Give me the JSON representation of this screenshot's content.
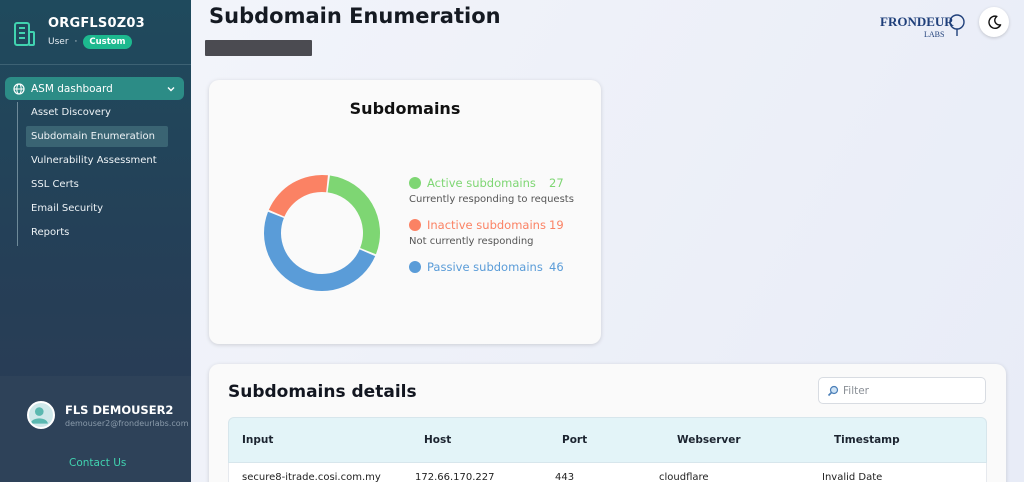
{
  "sidebar": {
    "org_name": "ORGFLS0Z03",
    "role": "User",
    "separator": "·",
    "badge": "Custom",
    "section": "ASM dashboard",
    "items": [
      {
        "label": "Asset Discovery",
        "active": false
      },
      {
        "label": "Subdomain Enumeration",
        "active": true
      },
      {
        "label": "Vulnerability Assessment",
        "active": false
      },
      {
        "label": "SSL Certs",
        "active": false
      },
      {
        "label": "Email Security",
        "active": false
      },
      {
        "label": "Reports",
        "active": false
      }
    ],
    "user": {
      "name": "FLS DEMOUSER2",
      "email": "demouser2@frondeurlabs.com",
      "contact": "Contact Us"
    }
  },
  "header": {
    "title": "Subdomain Enumeration",
    "logo_text": "FRONDEUR",
    "logo_sub": "LABS"
  },
  "summary": {
    "title": "Subdomains",
    "colors": {
      "active": "#7ed673",
      "inactive": "#fb8264",
      "passive": "#5a9cd8"
    },
    "legend": [
      {
        "label": "Active subdomains",
        "value": "27",
        "desc": "Currently responding to requests",
        "color": "#7ed673"
      },
      {
        "label": "Inactive subdomains",
        "value": "19",
        "desc": "Not currently responding",
        "color": "#fb8264"
      },
      {
        "label": "Passive subdomains",
        "value": "46",
        "desc": "",
        "color": "#5a9cd8"
      }
    ]
  },
  "chart_data": {
    "type": "pie",
    "categories": [
      "Active subdomains",
      "Inactive subdomains",
      "Passive subdomains"
    ],
    "values": [
      27,
      19,
      46
    ],
    "title": "Subdomains",
    "colors": [
      "#7ed673",
      "#fb8264",
      "#5a9cd8"
    ]
  },
  "details": {
    "title": "Subdomains details",
    "filter_placeholder": "Filter",
    "columns": [
      "Input",
      "Host",
      "Port",
      "Webserver",
      "Timestamp"
    ],
    "rows": [
      [
        "secure8-itrade.cosi.com.my",
        "172.66.170.227",
        "443",
        "cloudflare",
        "Invalid Date"
      ]
    ]
  }
}
